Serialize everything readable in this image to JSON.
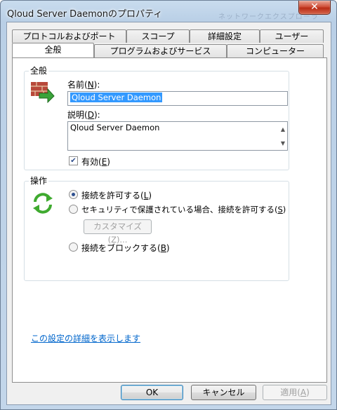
{
  "window": {
    "title": "Qloud Server Daemonのプロパティ",
    "close_glyph": "✕",
    "background_hint": "ネットワークエクスプローラ"
  },
  "tabs": {
    "row1": [
      "プロトコルおよびポート",
      "スコープ",
      "詳細設定",
      "ユーザー"
    ],
    "row2": [
      "全般",
      "プログラムおよびサービス",
      "コンピューター"
    ],
    "active": "全般"
  },
  "general": {
    "group_label": "全般",
    "name_label_prefix": "名前(",
    "name_label_key": "N",
    "name_label_suffix": "):",
    "name_value": "Qloud Server Daemon",
    "desc_label_prefix": "説明(",
    "desc_label_key": "D",
    "desc_label_suffix": "):",
    "desc_value": "Qloud Server Daemon",
    "enabled_label_prefix": "有効(",
    "enabled_label_key": "E",
    "enabled_label_suffix": ")",
    "enabled_checked": true,
    "icon": "firewall-rule-icon"
  },
  "action": {
    "group_label": "操作",
    "options": [
      {
        "prefix": "接続を許可する(",
        "key": "L",
        "suffix": ")",
        "selected": true
      },
      {
        "prefix": "セキュリティで保護されている場合、接続を許可する(",
        "key": "S",
        "suffix": ")",
        "selected": false
      },
      {
        "prefix": "接続をブロックする(",
        "key": "B",
        "suffix": ")",
        "selected": false
      }
    ],
    "customize_label": "カスタマイズ(Z)...",
    "icon": "refresh-arrows-icon"
  },
  "footer": {
    "help_link": "この設定の詳細を表示します",
    "ok_label": "OK",
    "cancel_label": "キャンセル",
    "apply_prefix": "適用(",
    "apply_key": "A",
    "apply_suffix": ")"
  }
}
